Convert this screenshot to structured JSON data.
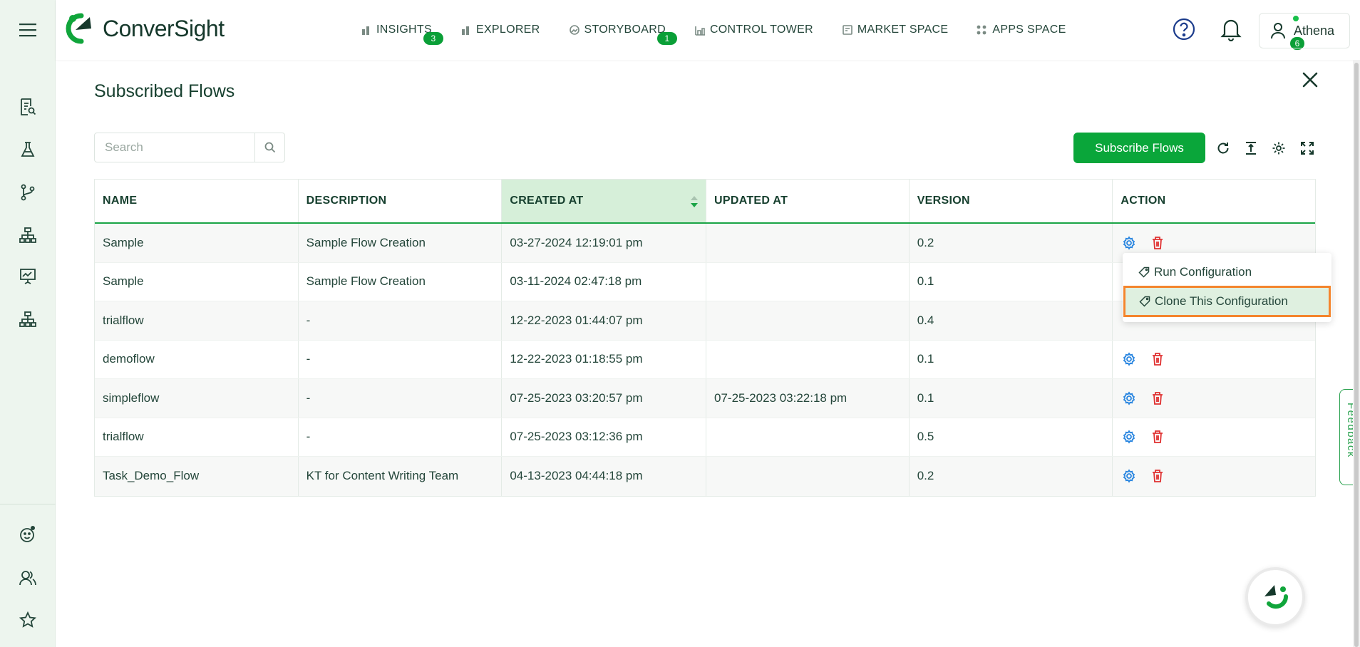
{
  "app": {
    "brand": "ConverSight",
    "brand_color": "#0a9f37",
    "accent_orange": "#f4852d"
  },
  "rail": {
    "items": [
      {
        "icon": "report-search-icon"
      },
      {
        "icon": "flask-icon"
      },
      {
        "icon": "flow-branch-icon"
      },
      {
        "icon": "hierarchy-icon"
      },
      {
        "icon": "presentation-chart-icon"
      },
      {
        "icon": "org-chart-icon"
      },
      {
        "icon": "bot-face-icon"
      },
      {
        "icon": "users-icon"
      },
      {
        "icon": "star-icon"
      }
    ]
  },
  "nav": {
    "items": [
      {
        "label": "INSIGHTS",
        "badge": "3",
        "icon": "bar-chart-icon"
      },
      {
        "label": "EXPLORER",
        "badge": "",
        "icon": "bar-chart-icon"
      },
      {
        "label": "STORYBOARD",
        "badge": "1",
        "icon": "storyboard-icon"
      },
      {
        "label": "CONTROL TOWER",
        "badge": "",
        "icon": "control-tower-icon"
      },
      {
        "label": "MARKET SPACE",
        "badge": "",
        "icon": "market-icon"
      },
      {
        "label": "APPS SPACE",
        "badge": "",
        "icon": "apps-grid-icon"
      }
    ]
  },
  "header": {
    "notifications_count": "6",
    "user_name": "Athena"
  },
  "page": {
    "title": "Subscribed Flows",
    "search_placeholder": "Search",
    "subscribe_label": "Subscribe Flows"
  },
  "table": {
    "columns": [
      "NAME",
      "DESCRIPTION",
      "CREATED AT",
      "UPDATED AT",
      "VERSION",
      "ACTION"
    ],
    "rows": [
      {
        "name": "Sample",
        "description": "Sample Flow Creation",
        "created": "03-27-2024 12:19:01 pm",
        "updated": "",
        "version": "0.2"
      },
      {
        "name": "Sample",
        "description": "Sample Flow Creation",
        "created": "03-11-2024 02:47:18 pm",
        "updated": "",
        "version": "0.1"
      },
      {
        "name": "trialflow",
        "description": "-",
        "created": "12-22-2023 01:44:07 pm",
        "updated": "",
        "version": "0.4"
      },
      {
        "name": "demoflow",
        "description": "-",
        "created": "12-22-2023 01:18:55 pm",
        "updated": "",
        "version": "0.1"
      },
      {
        "name": "simpleflow",
        "description": "-",
        "created": "07-25-2023 03:20:57 pm",
        "updated": "07-25-2023 03:22:18 pm",
        "version": "0.1"
      },
      {
        "name": "trialflow",
        "description": "-",
        "created": "07-25-2023 03:12:36 pm",
        "updated": "",
        "version": "0.5"
      },
      {
        "name": "Task_Demo_Flow",
        "description": "KT for Content Writing Team",
        "created": "04-13-2023 04:44:18 pm",
        "updated": "",
        "version": "0.2"
      }
    ]
  },
  "menu": {
    "run_label": "Run Configuration",
    "clone_label": "Clone This Configuration"
  },
  "feedback": {
    "label": "Feedback"
  }
}
